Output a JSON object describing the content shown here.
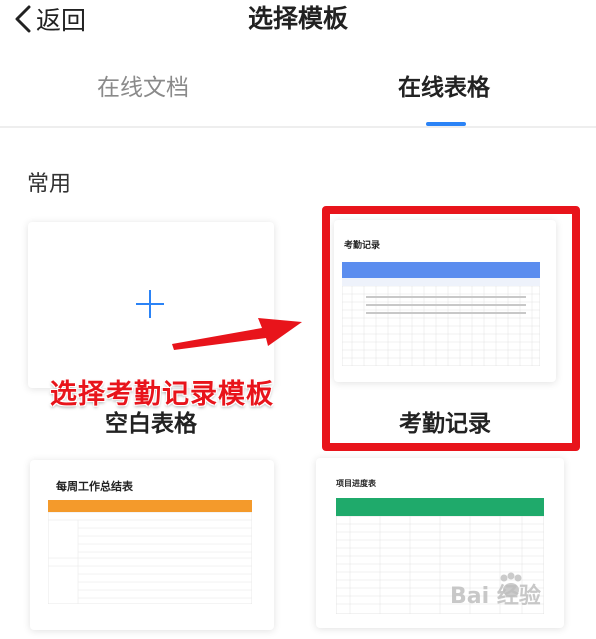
{
  "header": {
    "back_label": "返回",
    "title": "选择模板",
    "back_icon": "chevron-left-icon"
  },
  "tabs": [
    {
      "label": "在线文档",
      "active": false
    },
    {
      "label": "在线表格",
      "active": true
    }
  ],
  "section": {
    "title": "常用"
  },
  "templates": [
    {
      "label": "空白表格",
      "icon": "plus-icon"
    },
    {
      "label": "考勤记录",
      "thumb_title": "考勤记录",
      "highlighted": true
    },
    {
      "label": "",
      "thumb_title": "每周工作总结表"
    },
    {
      "label": "",
      "thumb_title": "项目进度表"
    }
  ],
  "annotation": {
    "text": "选择考勤记录模板"
  },
  "watermark": {
    "text": "Bai 经验"
  },
  "colors": {
    "accent": "#2b83f6",
    "highlight": "#e8141b",
    "attendance_header": "#5b8def",
    "weekly_header": "#f49a2b",
    "progress_header": "#1faa6b"
  }
}
